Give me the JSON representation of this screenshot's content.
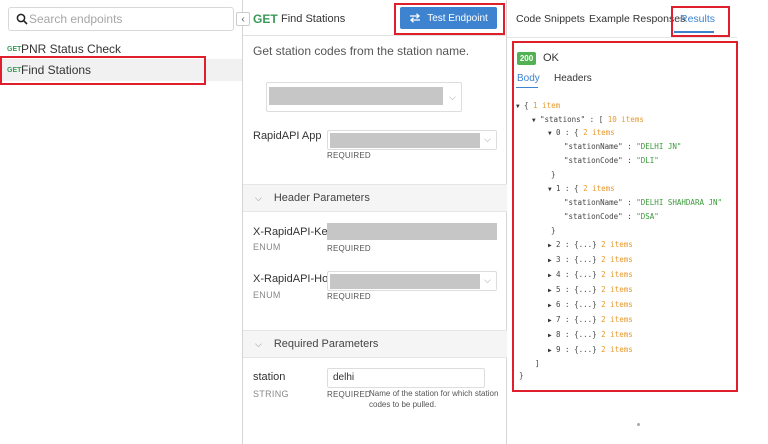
{
  "search": {
    "placeholder": "Search endpoints"
  },
  "sidebar": {
    "collapse_glyph": "‹",
    "endpoints": [
      {
        "method": "GET",
        "label": "PNR Status Check"
      },
      {
        "method": "GET",
        "label": "Find Stations",
        "selected": true
      }
    ]
  },
  "middle": {
    "method": "GET",
    "title": "Find Stations",
    "test_button": "Test Endpoint",
    "description": "Get station codes from the station name.",
    "app_label": "RapidAPI App",
    "required": "REQUIRED",
    "header_section": "Header Parameters",
    "required_section": "Required Parameters",
    "section_chevron": "⌵",
    "headers": [
      {
        "name": "X-RapidAPI-Key",
        "type": "ENUM"
      },
      {
        "name": "X-RapidAPI-Host",
        "type": "ENUM"
      }
    ],
    "params": [
      {
        "name": "station",
        "type": "STRING",
        "value": "delhi",
        "help": "Name of the station for which station codes to be pulled."
      }
    ]
  },
  "right": {
    "tabs": [
      "Code Snippets",
      "Example Responses",
      "Results"
    ],
    "active_tab": "Results",
    "status_code": "200",
    "status_text": "OK",
    "subtabs": [
      "Body",
      "Headers"
    ],
    "active_subtab": "Body"
  },
  "json_view": {
    "root_count": "1 item",
    "key_stations": "\"stations\"",
    "stations_count": "10 items",
    "item_count": "2 items",
    "collapsed": "{...}",
    "expanded": [
      {
        "index": "0",
        "stationName": "\"DELHI JN\"",
        "stationCode": "\"DLI\""
      },
      {
        "index": "1",
        "stationName": "\"DELHI SHAHDARA JN\"",
        "stationCode": "\"DSA\""
      }
    ],
    "key_name": "\"stationName\"",
    "key_code": "\"stationCode\"",
    "collapsed_indexes": [
      "2",
      "3",
      "4",
      "5",
      "6",
      "7",
      "8",
      "9"
    ]
  },
  "colors": {
    "accent": "#3d83cf",
    "get_method": "#3a9a57",
    "status_ok": "#52b153",
    "json_string": "#3c9a3c",
    "json_count": "#e69a2e",
    "highlight": "#e01f2d"
  }
}
